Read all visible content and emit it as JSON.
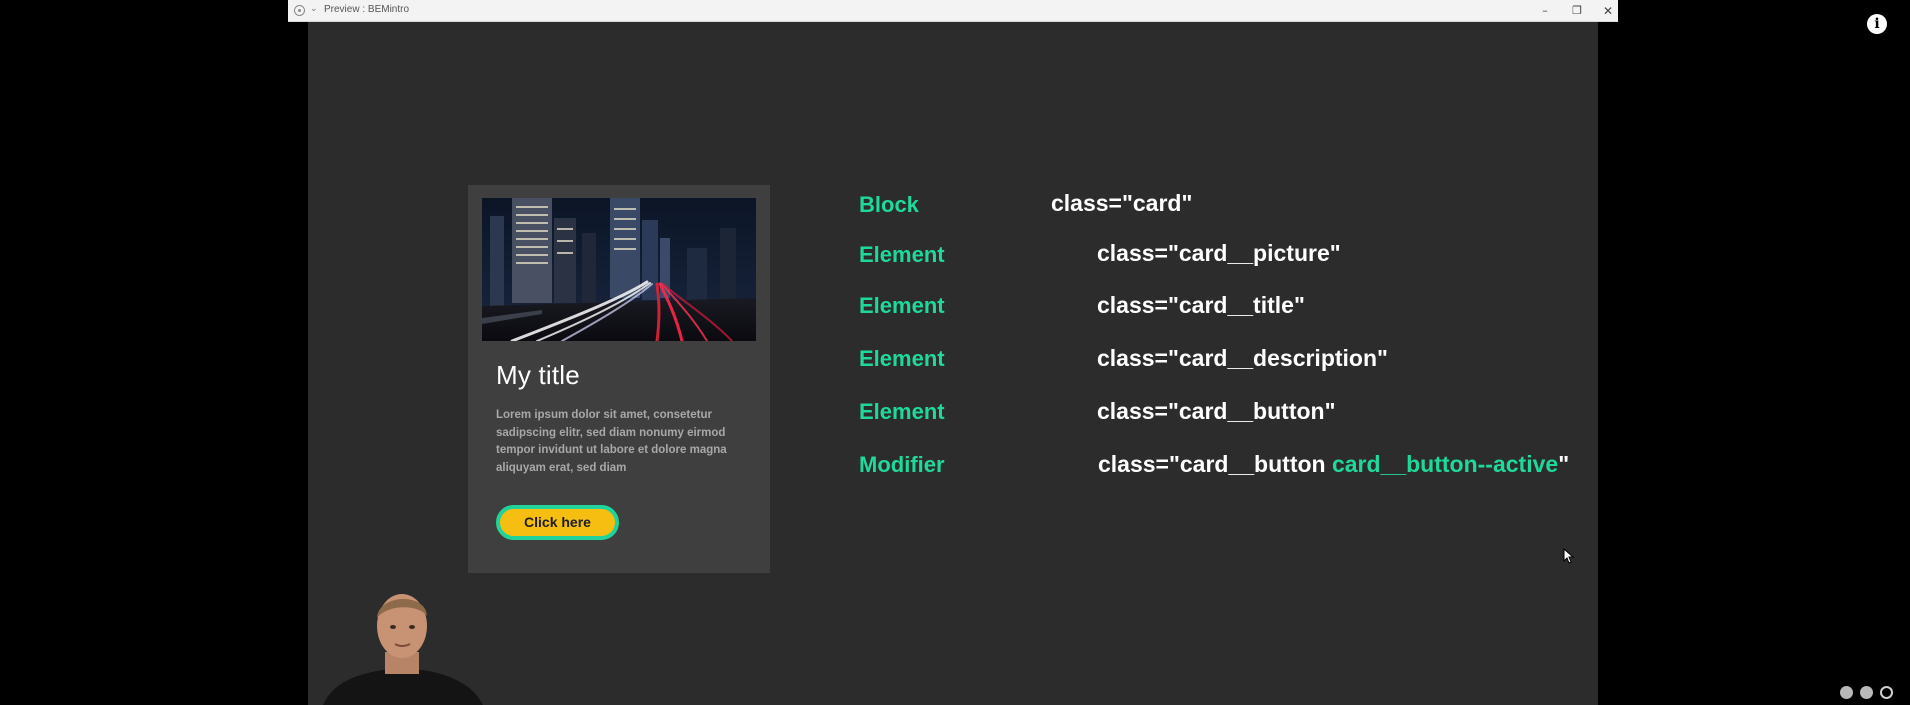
{
  "window": {
    "title": "Preview : BEMintro",
    "minimize_glyph": "–",
    "maximize_glyph": "❐",
    "close_glyph": "✕",
    "chevron_glyph": "⌄"
  },
  "card": {
    "title": "My title",
    "description": "Lorem ipsum dolor sit amet, consetetur sadipscing elitr, sed diam nonumy eirmod tempor invidunt ut labore et dolore magna aliquyam erat, sed diam",
    "button_label": "Click here",
    "picture_icon": "city-night-traffic-photo"
  },
  "bem": {
    "rows": [
      {
        "label": "Block",
        "code": "class=\"card\""
      },
      {
        "label": "Element",
        "code": "class=\"card__picture\""
      },
      {
        "label": "Element",
        "code": "class=\"card__title\""
      },
      {
        "label": "Element",
        "code": "class=\"card__description\""
      },
      {
        "label": "Element",
        "code": "class=\"card__button\""
      }
    ],
    "modifier": {
      "label": "Modifier",
      "code_prefix": "class=\"card__button ",
      "code_accent": "card__button--active",
      "code_suffix": "\""
    }
  },
  "overlay": {
    "info_glyph": "i"
  },
  "colors": {
    "accent": "#1fd99a",
    "slide_background": "#2c2c2c",
    "card_background": "#3f3f3f",
    "button_fill": "#f5be10",
    "button_border": "#21d39a"
  }
}
